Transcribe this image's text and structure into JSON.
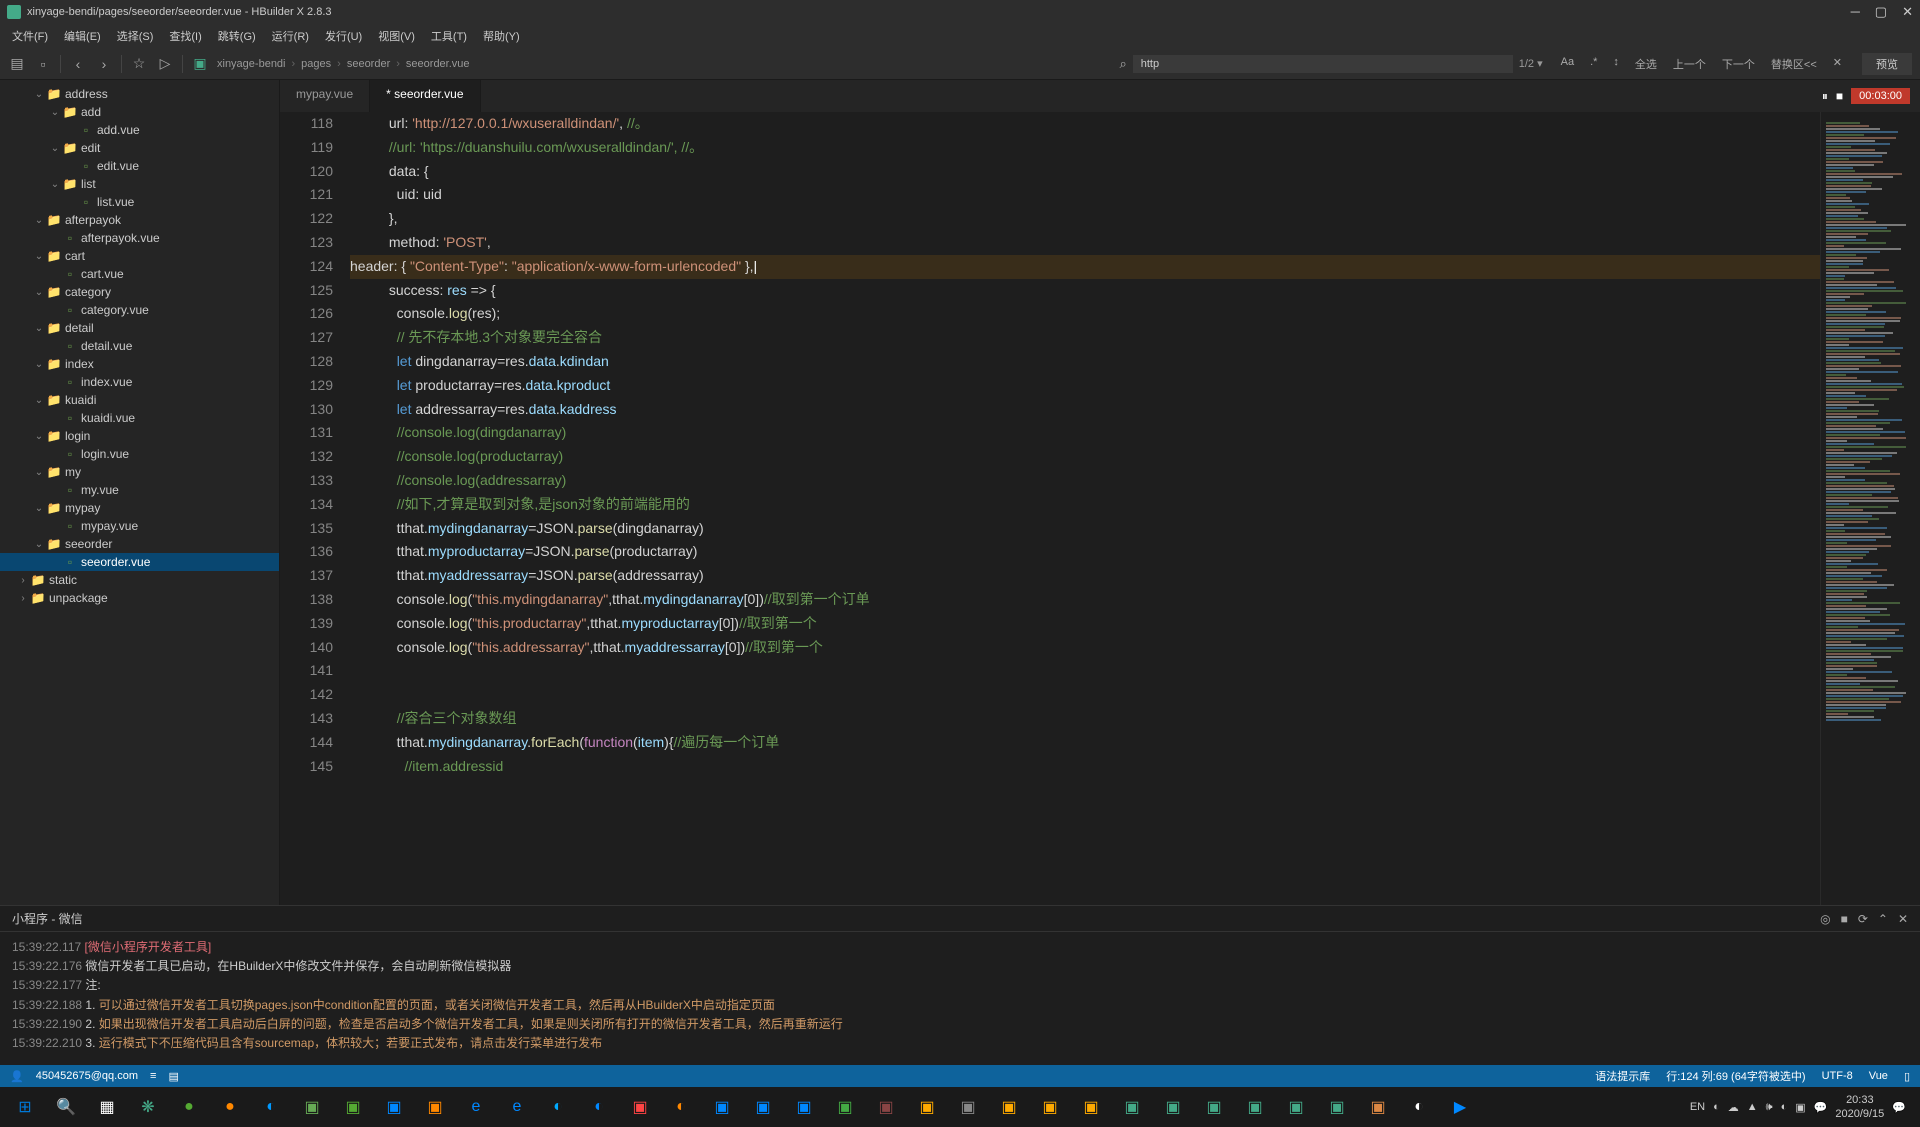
{
  "titlebar": {
    "title": "xinyage-bendi/pages/seeorder/seeorder.vue - HBuilder X 2.8.3"
  },
  "menubar": [
    "文件(F)",
    "编辑(E)",
    "选择(S)",
    "查找(I)",
    "跳转(G)",
    "运行(R)",
    "发行(U)",
    "视图(V)",
    "工具(T)",
    "帮助(Y)"
  ],
  "breadcrumb": [
    "xinyage-bendi",
    "pages",
    "seeorder",
    "seeorder.vue"
  ],
  "search": {
    "value": "http",
    "count": "1/2 ▾"
  },
  "searchTools": [
    "Aa",
    ".*",
    "↕",
    "全选",
    "上一个",
    "下一个",
    "替换区<<",
    "✕"
  ],
  "previewBtn": "预览",
  "tabs": [
    {
      "label": "mypay.vue",
      "active": false
    },
    {
      "label": "* seeorder.vue",
      "active": true
    }
  ],
  "recTime": "00:03:00",
  "tree": [
    {
      "d": 2,
      "t": "f",
      "n": "address",
      "e": true
    },
    {
      "d": 3,
      "t": "f",
      "n": "add",
      "e": true
    },
    {
      "d": 4,
      "t": "v",
      "n": "add.vue"
    },
    {
      "d": 3,
      "t": "f",
      "n": "edit",
      "e": true
    },
    {
      "d": 4,
      "t": "v",
      "n": "edit.vue"
    },
    {
      "d": 3,
      "t": "f",
      "n": "list",
      "e": true
    },
    {
      "d": 4,
      "t": "v",
      "n": "list.vue"
    },
    {
      "d": 2,
      "t": "f",
      "n": "afterpayok",
      "e": true
    },
    {
      "d": 3,
      "t": "v",
      "n": "afterpayok.vue"
    },
    {
      "d": 2,
      "t": "f",
      "n": "cart",
      "e": true
    },
    {
      "d": 3,
      "t": "v",
      "n": "cart.vue"
    },
    {
      "d": 2,
      "t": "f",
      "n": "category",
      "e": true
    },
    {
      "d": 3,
      "t": "v",
      "n": "category.vue"
    },
    {
      "d": 2,
      "t": "f",
      "n": "detail",
      "e": true
    },
    {
      "d": 3,
      "t": "v",
      "n": "detail.vue"
    },
    {
      "d": 2,
      "t": "f",
      "n": "index",
      "e": true
    },
    {
      "d": 3,
      "t": "v",
      "n": "index.vue"
    },
    {
      "d": 2,
      "t": "f",
      "n": "kuaidi",
      "e": true
    },
    {
      "d": 3,
      "t": "v",
      "n": "kuaidi.vue"
    },
    {
      "d": 2,
      "t": "f",
      "n": "login",
      "e": true
    },
    {
      "d": 3,
      "t": "v",
      "n": "login.vue"
    },
    {
      "d": 2,
      "t": "f",
      "n": "my",
      "e": true
    },
    {
      "d": 3,
      "t": "v",
      "n": "my.vue"
    },
    {
      "d": 2,
      "t": "f",
      "n": "mypay",
      "e": true
    },
    {
      "d": 3,
      "t": "v",
      "n": "mypay.vue"
    },
    {
      "d": 2,
      "t": "f",
      "n": "seeorder",
      "e": true
    },
    {
      "d": 3,
      "t": "v",
      "n": "seeorder.vue",
      "sel": true
    },
    {
      "d": 1,
      "t": "f",
      "n": "static",
      "e": false
    },
    {
      "d": 1,
      "t": "f",
      "n": "unpackage",
      "e": false
    }
  ],
  "code": {
    "start": 118,
    "lines": [
      {
        "seg": [
          [
            "p",
            "          url: "
          ],
          [
            "s",
            "'http://127.0.0.1/wxuseralldindan/'"
          ],
          [
            "p",
            ", "
          ],
          [
            "c",
            "//。"
          ]
        ]
      },
      {
        "seg": [
          [
            "p",
            "          "
          ],
          [
            "c",
            "//url: 'https://duanshuilu.com/wxuseralldindan/', //。"
          ]
        ]
      },
      {
        "seg": [
          [
            "p",
            "          data: {"
          ]
        ]
      },
      {
        "seg": [
          [
            "p",
            "            uid: uid"
          ]
        ]
      },
      {
        "seg": [
          [
            "p",
            "          },"
          ]
        ]
      },
      {
        "seg": [
          [
            "p",
            "          method: "
          ],
          [
            "s",
            "'POST'"
          ],
          [
            "p",
            ","
          ]
        ]
      },
      {
        "hl": true,
        "seg": [
          [
            "p",
            "header: { "
          ],
          [
            "s",
            "\"Content-Type\""
          ],
          [
            "p",
            ": "
          ],
          [
            "s",
            "\"application/x-www-form-urlencoded\""
          ],
          [
            "p",
            " },"
          ]
        ]
      },
      {
        "seg": [
          [
            "p",
            "          success: "
          ],
          [
            "v",
            "res"
          ],
          [
            "p",
            " => {"
          ]
        ]
      },
      {
        "seg": [
          [
            "p",
            "            console."
          ],
          [
            "f",
            "log"
          ],
          [
            "p",
            "(res);"
          ]
        ]
      },
      {
        "seg": [
          [
            "p",
            "            "
          ],
          [
            "c",
            "// 先不存本地.3个对象要完全容合"
          ]
        ]
      },
      {
        "seg": [
          [
            "p",
            "            "
          ],
          [
            "k",
            "let"
          ],
          [
            "p",
            " dingdanarray=res."
          ],
          [
            "v",
            "data"
          ],
          [
            "p",
            "."
          ],
          [
            "v",
            "kdindan"
          ]
        ]
      },
      {
        "seg": [
          [
            "p",
            "            "
          ],
          [
            "k",
            "let"
          ],
          [
            "p",
            " productarray=res."
          ],
          [
            "v",
            "data"
          ],
          [
            "p",
            "."
          ],
          [
            "v",
            "kproduct"
          ]
        ]
      },
      {
        "seg": [
          [
            "p",
            "            "
          ],
          [
            "k",
            "let"
          ],
          [
            "p",
            " addressarray=res."
          ],
          [
            "v",
            "data"
          ],
          [
            "p",
            "."
          ],
          [
            "v",
            "kaddress"
          ]
        ]
      },
      {
        "seg": [
          [
            "p",
            "            "
          ],
          [
            "c",
            "//console.log(dingdanarray)"
          ]
        ]
      },
      {
        "seg": [
          [
            "p",
            "            "
          ],
          [
            "c",
            "//console.log(productarray)"
          ]
        ]
      },
      {
        "seg": [
          [
            "p",
            "            "
          ],
          [
            "c",
            "//console.log(addressarray)"
          ]
        ]
      },
      {
        "seg": [
          [
            "p",
            "            "
          ],
          [
            "c",
            "//如下,才算是取到对象,是json对象的前端能用的"
          ]
        ]
      },
      {
        "seg": [
          [
            "p",
            "            tthat."
          ],
          [
            "v",
            "mydingdanarray"
          ],
          [
            "p",
            "=JSON."
          ],
          [
            "f",
            "parse"
          ],
          [
            "p",
            "(dingdanarray)"
          ]
        ]
      },
      {
        "seg": [
          [
            "p",
            "            tthat."
          ],
          [
            "v",
            "myproductarray"
          ],
          [
            "p",
            "=JSON."
          ],
          [
            "f",
            "parse"
          ],
          [
            "p",
            "(productarray)"
          ]
        ]
      },
      {
        "seg": [
          [
            "p",
            "            tthat."
          ],
          [
            "v",
            "myaddressarray"
          ],
          [
            "p",
            "=JSON."
          ],
          [
            "f",
            "parse"
          ],
          [
            "p",
            "(addressarray)"
          ]
        ]
      },
      {
        "seg": [
          [
            "p",
            "            console."
          ],
          [
            "f",
            "log"
          ],
          [
            "p",
            "("
          ],
          [
            "s",
            "\"this.mydingdanarray\""
          ],
          [
            "p",
            ",tthat."
          ],
          [
            "v",
            "mydingdanarray"
          ],
          [
            "p",
            "[0])"
          ],
          [
            "c",
            "//取到第一个订单"
          ]
        ]
      },
      {
        "seg": [
          [
            "p",
            "            console."
          ],
          [
            "f",
            "log"
          ],
          [
            "p",
            "("
          ],
          [
            "s",
            "\"this.productarray\""
          ],
          [
            "p",
            ",tthat."
          ],
          [
            "v",
            "myproductarray"
          ],
          [
            "p",
            "[0])"
          ],
          [
            "c",
            "//取到第一个"
          ]
        ]
      },
      {
        "seg": [
          [
            "p",
            "            console."
          ],
          [
            "f",
            "log"
          ],
          [
            "p",
            "("
          ],
          [
            "s",
            "\"this.addressarray\""
          ],
          [
            "p",
            ",tthat."
          ],
          [
            "v",
            "myaddressarray"
          ],
          [
            "p",
            "[0])"
          ],
          [
            "c",
            "//取到第一个"
          ]
        ]
      },
      {
        "seg": [
          [
            "p",
            " "
          ]
        ]
      },
      {
        "seg": [
          [
            "p",
            " "
          ]
        ]
      },
      {
        "seg": [
          [
            "p",
            "            "
          ],
          [
            "c",
            "//容合三个对象数组"
          ]
        ]
      },
      {
        "seg": [
          [
            "p",
            "            tthat."
          ],
          [
            "v",
            "mydingdanarray"
          ],
          [
            "p",
            "."
          ],
          [
            "f",
            "forEach"
          ],
          [
            "p",
            "("
          ],
          [
            "fn",
            "function"
          ],
          [
            "p",
            "("
          ],
          [
            "v",
            "item"
          ],
          [
            "p",
            "){"
          ],
          [
            "c",
            "//遍历每一个订单"
          ]
        ]
      },
      {
        "seg": [
          [
            "p",
            "              "
          ],
          [
            "c",
            "//item.addressid"
          ]
        ]
      }
    ]
  },
  "panel": {
    "title": "小程序 - 微信",
    "lines": [
      {
        "t": "15:39:22.117",
        "seg": [
          [
            "r",
            "[微信小程序开发者工具]"
          ]
        ]
      },
      {
        "t": "15:39:22.176",
        "seg": [
          [
            "w",
            "微信开发者工具已启动，在HBuilderX中修改文件并保存，会自动刷新微信模拟器"
          ]
        ]
      },
      {
        "t": "15:39:22.177",
        "seg": [
          [
            "w",
            "注:"
          ]
        ]
      },
      {
        "t": "15:39:22.188",
        "seg": [
          [
            "w",
            "1. "
          ],
          [
            "y",
            "可以通过微信开发者工具切换pages.json中condition配置的页面，或者关闭微信开发者工具，然后再从HBuilderX中启动指定页面"
          ]
        ]
      },
      {
        "t": "15:39:22.190",
        "seg": [
          [
            "w",
            "2. "
          ],
          [
            "y",
            "如果出现微信开发者工具启动后白屏的问题，检查是否启动多个微信开发者工具，如果是则关闭所有打开的微信开发者工具，然后再重新运行"
          ]
        ]
      },
      {
        "t": "15:39:22.210",
        "seg": [
          [
            "w",
            "3. "
          ],
          [
            "y",
            "运行模式下不压缩代码且含有sourcemap，体积较大；若要正式发布，请点击发行菜单进行发布"
          ]
        ]
      }
    ]
  },
  "statusbar": {
    "user": "450452675@qq.com",
    "syntax": "语法提示库",
    "pos": "行:124  列:69 (64字符被选中)",
    "enc": "UTF-8",
    "lang": "Vue"
  },
  "taskbar": {
    "icons": [
      "⊞",
      "🔍",
      "▦",
      "❋",
      "●",
      "●",
      "◐",
      "▣",
      "▣",
      "▣",
      "▣",
      "e",
      "e",
      "◐",
      "◐",
      "▣",
      "◐",
      "▣",
      "▣",
      "▣",
      "▣",
      "▣",
      "▣",
      "▣",
      "▣",
      "▣",
      "▣",
      "▣",
      "▣",
      "▣",
      "▣",
      "▣",
      "▣",
      "▣",
      "◐",
      "▶"
    ],
    "trayIcons": [
      "EN",
      "◐",
      "☁",
      "▲",
      "🕪",
      "◐",
      "▣",
      "💬"
    ],
    "clock": {
      "time": "20:33",
      "date": "2020/9/15"
    }
  }
}
